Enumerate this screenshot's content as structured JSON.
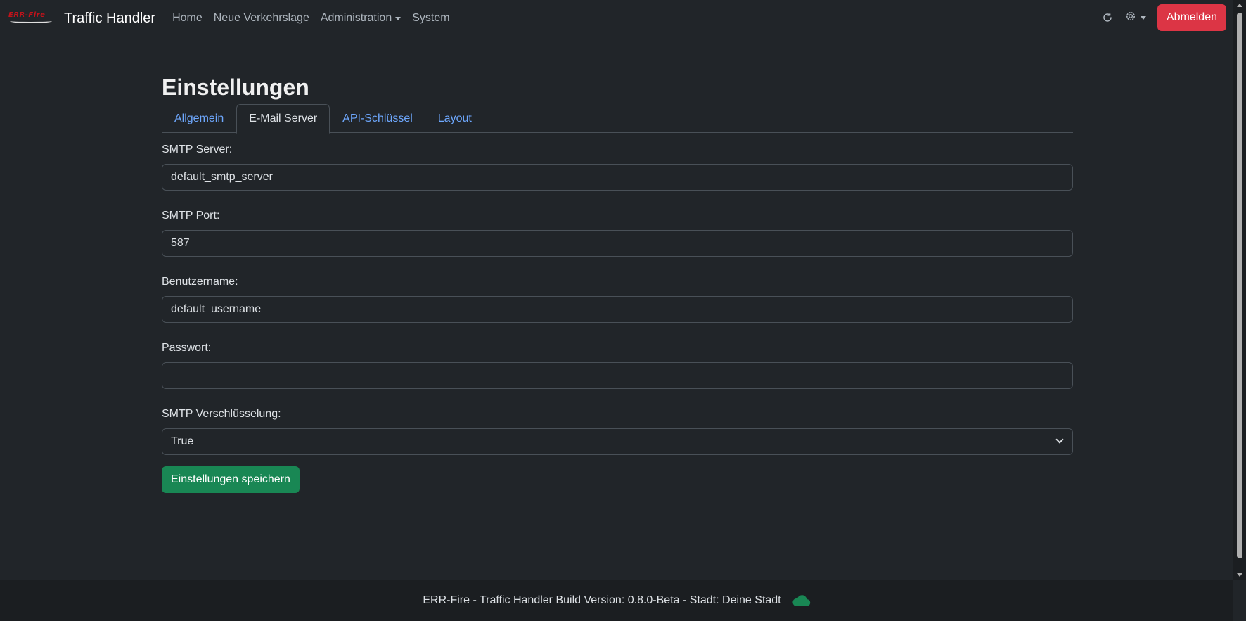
{
  "brand": {
    "logo_text": "ERR-Fire",
    "name": "Traffic Handler"
  },
  "nav": {
    "items": [
      {
        "label": "Home"
      },
      {
        "label": "Neue Verkehrslage"
      },
      {
        "label": "Administration"
      },
      {
        "label": "System"
      }
    ],
    "logout_label": "Abmelden"
  },
  "icons": {
    "refresh": "refresh-icon",
    "settings": "gear-icon",
    "status": "cloud-icon"
  },
  "colors": {
    "logout": "#dc3545",
    "save": "#198754",
    "link": "#6ea8fe",
    "status_ok": "#198754"
  },
  "main": {
    "title": "Einstellungen",
    "tabs": [
      {
        "label": "Allgemein",
        "active": false
      },
      {
        "label": "E-Mail Server",
        "active": true
      },
      {
        "label": "API-Schlüssel",
        "active": false
      },
      {
        "label": "Layout",
        "active": false
      }
    ],
    "form": {
      "smtp_server_label": "SMTP Server:",
      "smtp_server_value": "default_smtp_server",
      "smtp_port_label": "SMTP Port:",
      "smtp_port_value": "587",
      "username_label": "Benutzername:",
      "username_value": "default_username",
      "password_label": "Passwort:",
      "password_value": "",
      "encryption_label": "SMTP Verschlüsselung:",
      "encryption_value": "True",
      "save_label": "Einstellungen speichern"
    }
  },
  "footer": {
    "text": "ERR-Fire - Traffic Handler Build Version: 0.8.0-Beta - Stadt: Deine Stadt"
  }
}
